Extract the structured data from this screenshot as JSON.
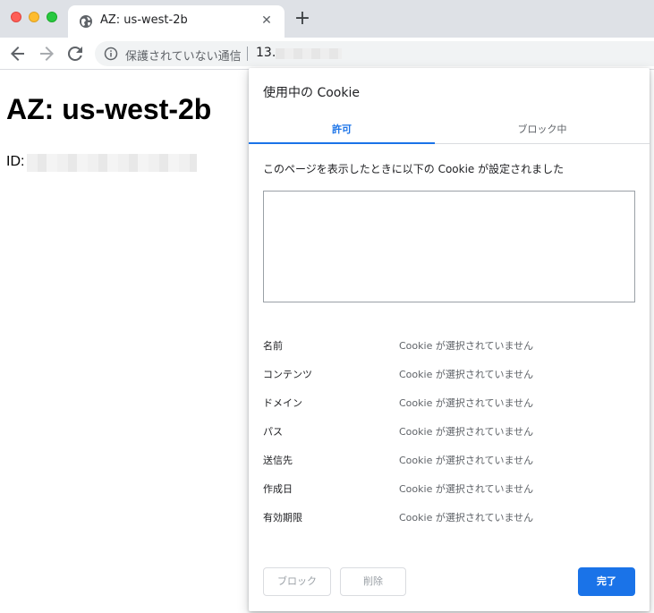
{
  "browser": {
    "tab": {
      "title": "AZ: us-west-2b",
      "favicon": "globe-icon",
      "close_glyph": "✕"
    },
    "new_tab_glyph": "+",
    "omnibox": {
      "security_label": "保護されていない通信",
      "url_visible": "13."
    }
  },
  "page": {
    "heading": "AZ: us-west-2b",
    "id_label": "ID:"
  },
  "dialog": {
    "title": "使用中の Cookie",
    "tabs": [
      {
        "label": "許可",
        "active": true
      },
      {
        "label": "ブロック中",
        "active": false
      }
    ],
    "description": "このページを表示したときに以下の Cookie が設定されました",
    "details": [
      {
        "label": "名前",
        "value": "Cookie が選択されていません"
      },
      {
        "label": "コンテンツ",
        "value": "Cookie が選択されていません"
      },
      {
        "label": "ドメイン",
        "value": "Cookie が選択されていません"
      },
      {
        "label": "パス",
        "value": "Cookie が選択されていません"
      },
      {
        "label": "送信先",
        "value": "Cookie が選択されていません"
      },
      {
        "label": "作成日",
        "value": "Cookie が選択されていません"
      },
      {
        "label": "有効期限",
        "value": "Cookie が選択されていません"
      }
    ],
    "buttons": {
      "block": "ブロック",
      "delete": "削除",
      "done": "完了"
    }
  },
  "colors": {
    "accent": "#1a73e8",
    "tabstrip": "#dee1e6",
    "omnibox": "#f1f3f4"
  }
}
